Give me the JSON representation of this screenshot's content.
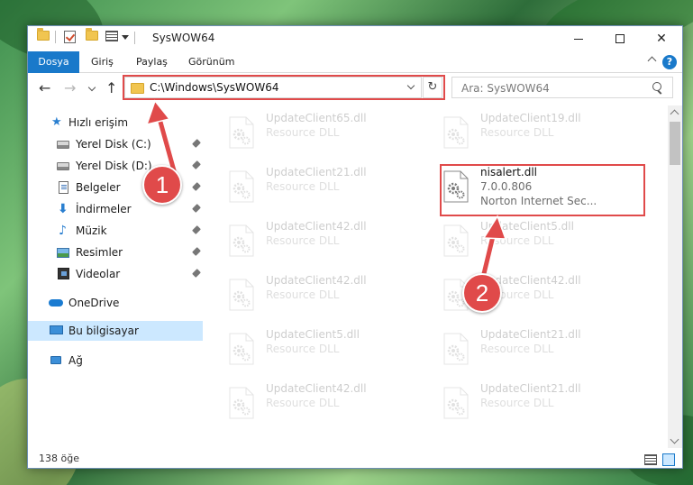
{
  "window": {
    "title": "SysWOW64",
    "controls": {
      "minimize": "minimize",
      "maximize": "maximize",
      "close": "✕"
    }
  },
  "ribbon": {
    "tabs": [
      "Dosya",
      "Giriş",
      "Paylaş",
      "Görünüm"
    ],
    "help": "?"
  },
  "address": {
    "path": "C:\\Windows\\SysWOW64",
    "search_placeholder": "Ara: SysWOW64"
  },
  "nav": {
    "items": [
      {
        "label": "Hızlı erişim",
        "icon": "star-icon",
        "pinned": false
      },
      {
        "label": "Yerel Disk (C:)",
        "icon": "disk-icon",
        "pinned": true
      },
      {
        "label": "Yerel Disk (D:)",
        "icon": "disk-icon",
        "pinned": true
      },
      {
        "label": "Belgeler",
        "icon": "documents-icon",
        "pinned": true
      },
      {
        "label": "İndirmeler",
        "icon": "download-icon",
        "pinned": true
      },
      {
        "label": "Müzik",
        "icon": "music-icon",
        "pinned": true
      },
      {
        "label": "Resimler",
        "icon": "pictures-icon",
        "pinned": true
      },
      {
        "label": "Videolar",
        "icon": "videos-icon",
        "pinned": true
      },
      {
        "label": "OneDrive",
        "icon": "cloud-icon",
        "pinned": false
      },
      {
        "label": "Bu bilgisayar",
        "icon": "computer-icon",
        "pinned": false,
        "selected": true
      },
      {
        "label": "Ağ",
        "icon": "network-icon",
        "pinned": false
      }
    ]
  },
  "files": {
    "left_column": [
      {
        "name": "UpdateClient65.dll",
        "type": "Resource DLL"
      },
      {
        "name": "UpdateClient21.dll",
        "type": "Resource DLL"
      },
      {
        "name": "UpdateClient42.dll",
        "type": "Resource DLL"
      },
      {
        "name": "UpdateClient42.dll",
        "type": "Resource DLL"
      },
      {
        "name": "UpdateClient5.dll",
        "type": "Resource DLL"
      },
      {
        "name": "UpdateClient42.dll",
        "type": "Resource DLL"
      }
    ],
    "right_column": [
      {
        "name": "UpdateClient19.dll",
        "type": "Resource DLL"
      },
      {
        "name": "UpdateClient5.dll",
        "type": "Resource DLL"
      },
      {
        "name": "UpdateClient42.dll",
        "type": "Resource DLL"
      },
      {
        "name": "UpdateClient21.dll",
        "type": "Resource DLL"
      },
      {
        "name": "UpdateClient21.dll",
        "type": "Resource DLL"
      }
    ],
    "highlighted": {
      "name": "nisalert.dll",
      "version": "7.0.0.806",
      "company": "Norton Internet Sec..."
    }
  },
  "status": {
    "item_count": "138 öğe"
  },
  "annotations": {
    "step1": "1",
    "step2": "2",
    "color": "#e04a4a"
  },
  "colors": {
    "accent": "#1979ca",
    "selection": "#cce8ff",
    "highlight": "#e04a4a"
  }
}
